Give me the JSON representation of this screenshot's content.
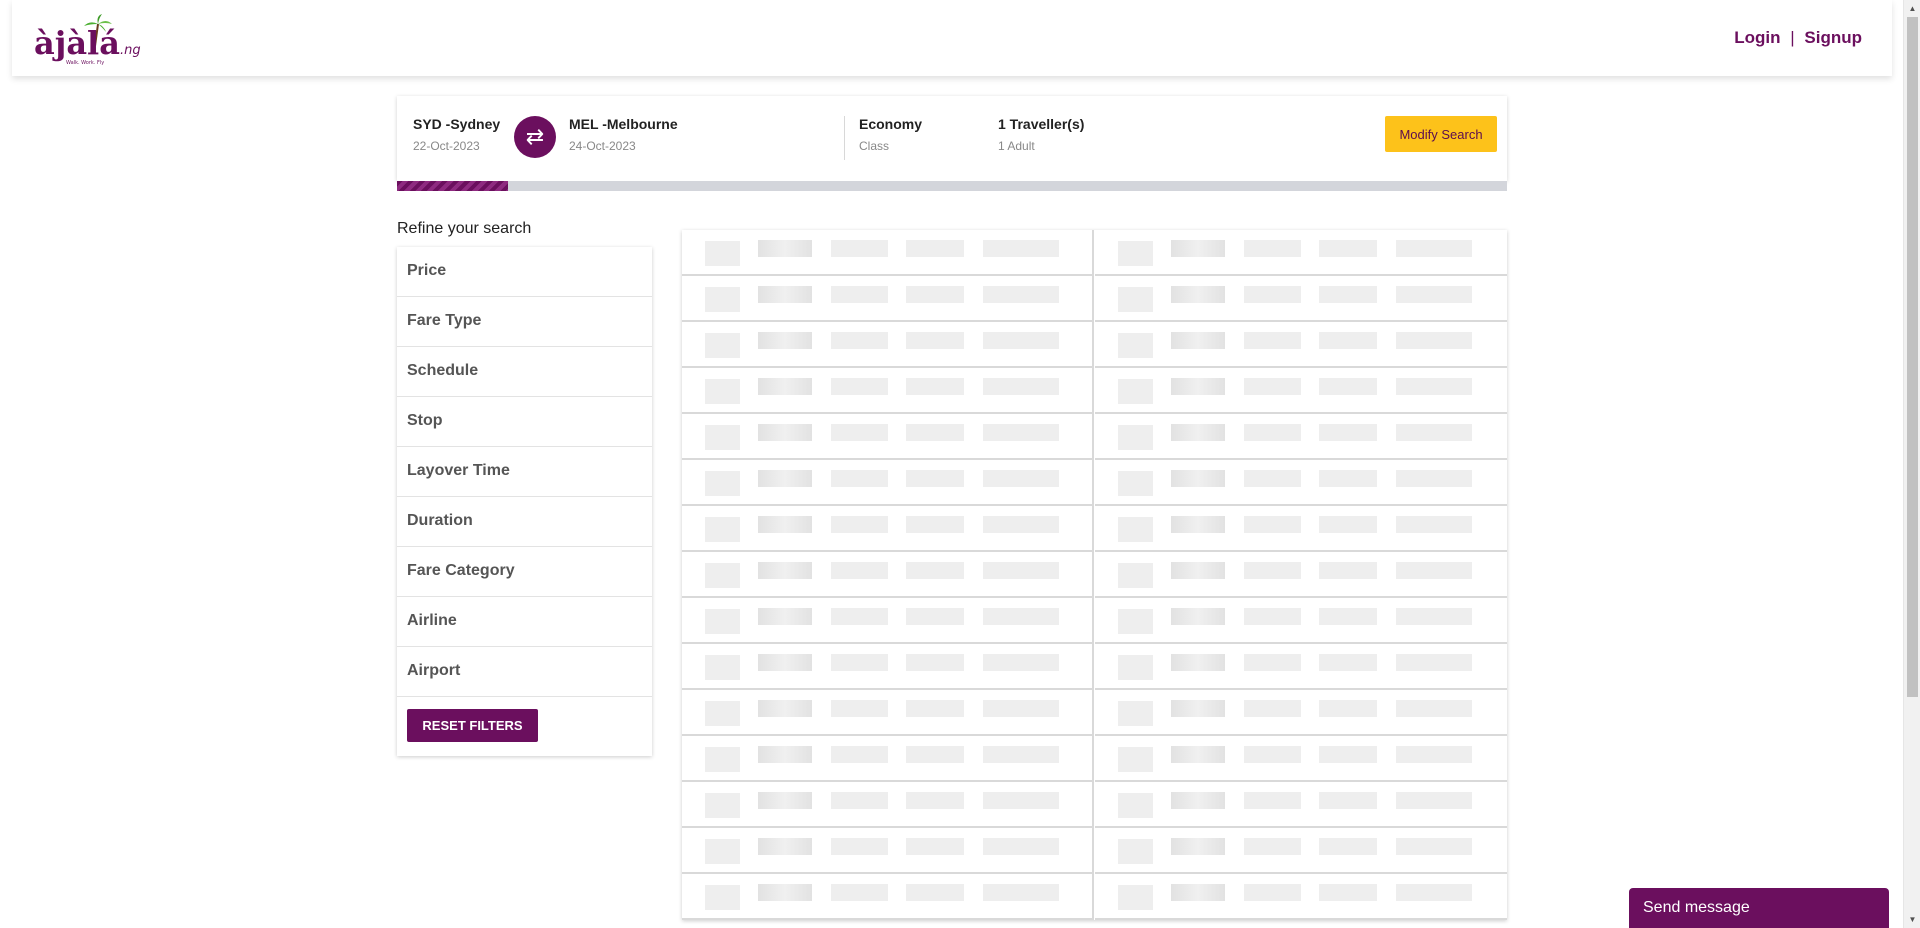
{
  "header": {
    "login_label": "Login",
    "separator": "|",
    "signup_label": "Signup",
    "brand_color": "#6b0f5e"
  },
  "summary": {
    "origin": {
      "code": "SYD -Sydney",
      "date": "22-Oct-2023"
    },
    "destination": {
      "code": "MEL -Melbourne",
      "date": "24-Oct-2023"
    },
    "swap_icon": "⇄",
    "cabin": {
      "value": "Economy",
      "label": "Class"
    },
    "travellers": {
      "value": "1 Traveller(s)",
      "label": "1 Adult"
    },
    "modify_label": "Modify Search",
    "modify_color": "#fdc21a",
    "progress_fraction": 0.1
  },
  "filters": {
    "title": "Refine your search",
    "items": [
      {
        "label": "Price"
      },
      {
        "label": "Fare Type"
      },
      {
        "label": "Schedule"
      },
      {
        "label": "Stop"
      },
      {
        "label": "Layover Time"
      },
      {
        "label": "Duration"
      },
      {
        "label": "Fare Category"
      },
      {
        "label": "Airline"
      },
      {
        "label": "Airport"
      }
    ],
    "reset_label": "RESET FILTERS"
  },
  "results": {
    "loading": true,
    "skeleton_rows_per_column": 15
  },
  "chat": {
    "label": "Send message"
  }
}
